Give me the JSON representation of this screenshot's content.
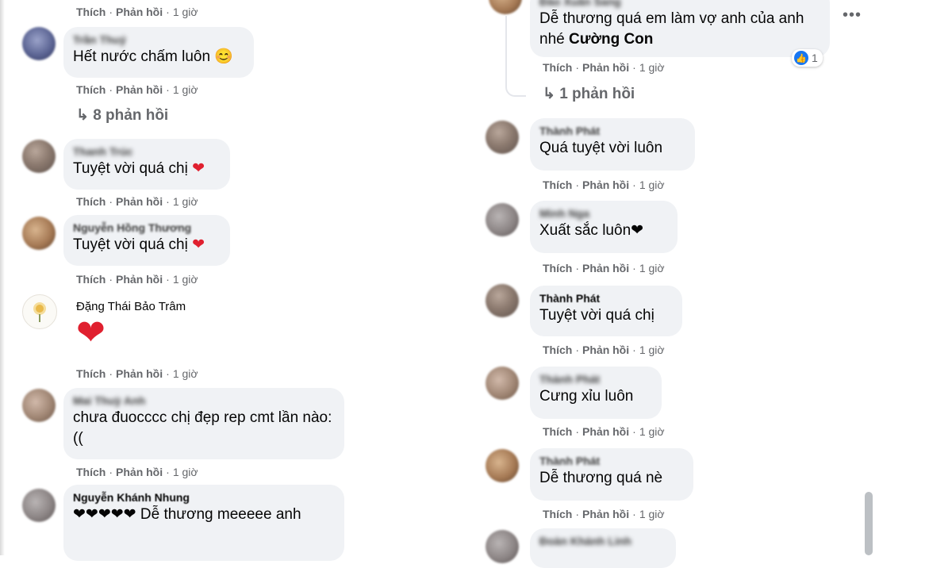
{
  "action_like": "Thích",
  "action_reply": "Phản hồi",
  "separator": "·",
  "left_column": [
    {
      "name": "",
      "text": "",
      "time": "1 giờ"
    },
    {
      "name": "Trần Thuý",
      "text": "Hết nước chấm luôn 😊",
      "time": "1 giờ",
      "replies": "8 phản hồi"
    },
    {
      "name": "Thanh Trúc",
      "text": "Tuyệt vời quá chị",
      "time": "1 giờ"
    },
    {
      "name": "Nguyễn Hồng Thương",
      "text": "Tuyệt vời quá chị",
      "time": "1 giờ"
    },
    {
      "name": "Đặng Thái Bảo Trâm",
      "text": "❤",
      "time": "1 giờ"
    },
    {
      "name": "Mai Thuỳ Anh",
      "text": "chưa đuocccc chị đẹp rep cmt lần nào:((",
      "time": "1 giờ"
    },
    {
      "name": "Nguyễn Khánh Nhung",
      "text": "❤❤❤❤❤ Dễ thương meeeee anh",
      "time": ""
    }
  ],
  "right_column": [
    {
      "name": "Đào Xuân Sang",
      "text": "Dễ thương quá em làm vợ anh của anh nhé",
      "mention": "Cường Con",
      "time": "1 giờ",
      "reaction_count": "1",
      "replies": "1 phản hồi"
    },
    {
      "name": "Thành Phát",
      "text": "Quá tuyệt vời luôn",
      "time": "1 giờ"
    },
    {
      "name": "Minh Nga",
      "text": "Xuất sắc luôn❤",
      "time": "1 giờ"
    },
    {
      "name": "Thành Phát",
      "text": "Tuyệt vời quá chị",
      "time": "1 giờ"
    },
    {
      "name": "Thành Phát",
      "text": "Cưng xỉu luôn",
      "time": "1 giờ"
    },
    {
      "name": "Thành Phát",
      "text": "Dễ thương quá nè",
      "time": "1 giờ"
    },
    {
      "name": "Đoàn Khánh Linh",
      "text": "",
      "time": ""
    }
  ],
  "icons": {
    "reply_arrow": "reply-arrow-icon",
    "more": "more-options-icon",
    "like": "like-reaction-icon"
  },
  "colors": {
    "bubble": "#f0f2f5",
    "meta": "#65676b",
    "heart": "#e0202f",
    "like": "#1877f2"
  }
}
